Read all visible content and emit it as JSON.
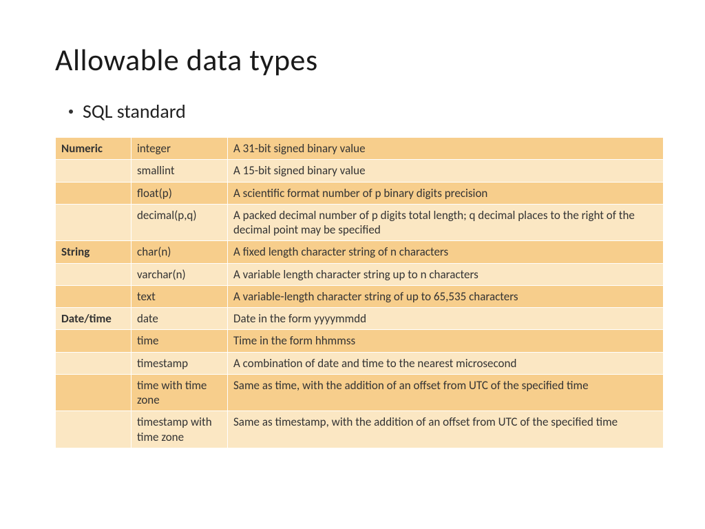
{
  "title": "Allowable data types",
  "bullet": "SQL standard",
  "rows": [
    {
      "shade": "dark",
      "cat": "Numeric",
      "type": "integer",
      "desc": "A 31-bit signed binary value"
    },
    {
      "shade": "light",
      "cat": "",
      "type": "smallint",
      "desc": "A 15-bit signed binary value"
    },
    {
      "shade": "dark",
      "cat": "",
      "type": "float(p)",
      "desc": "A scientific format number of p binary digits precision"
    },
    {
      "shade": "light",
      "cat": "",
      "type": "decimal(p,q)",
      "desc": "A packed decimal number of p digits total length; q decimal places to the right of the decimal point may be specified"
    },
    {
      "shade": "dark",
      "cat": "String",
      "type": "char(n)",
      "desc": "A fixed length character string of n characters"
    },
    {
      "shade": "light",
      "cat": "",
      "type": "varchar(n)",
      "desc": "A variable length character string up to n characters"
    },
    {
      "shade": "dark",
      "cat": "",
      "type": "text",
      "desc": "A variable-length character string of up to 65,535 characters"
    },
    {
      "shade": "light",
      "cat": "Date/time",
      "type": "date",
      "desc": "Date in the form yyyymmdd"
    },
    {
      "shade": "dark",
      "cat": "",
      "type": "time",
      "desc": "Time in the form hhmmss"
    },
    {
      "shade": "light",
      "cat": "",
      "type": "timestamp",
      "desc": "A combination of date and time to the nearest microsecond"
    },
    {
      "shade": "dark",
      "cat": "",
      "type": "time with time zone",
      "desc": "Same as time, with the addition of an offset from UTC of the specified time"
    },
    {
      "shade": "light",
      "cat": "",
      "type": "timestamp with time zone",
      "desc": "Same as timestamp, with the addition of an offset from UTC of the specified time"
    }
  ]
}
